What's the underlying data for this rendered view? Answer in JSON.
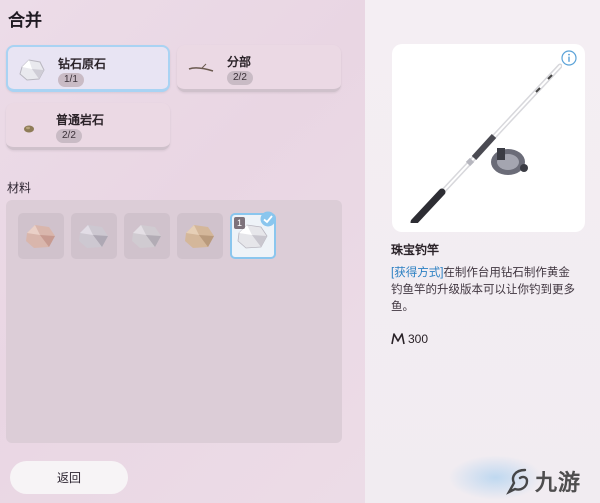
{
  "header": {
    "title": "合并"
  },
  "recipes": [
    {
      "name": "钻石原石",
      "count": "1/1",
      "icon": "diamond-ore-icon",
      "selected": true
    },
    {
      "name": "分部",
      "count": "2/2",
      "icon": "branch-icon",
      "selected": false
    },
    {
      "name": "普通岩石",
      "count": "2/2",
      "icon": "common-rock-icon",
      "selected": false
    }
  ],
  "materials": {
    "label": "材料",
    "slots": [
      {
        "icon": "pink-stone-icon",
        "count": "",
        "selected": false
      },
      {
        "icon": "gray-stone-icon",
        "count": "",
        "selected": false
      },
      {
        "icon": "gray-stone-icon",
        "count": "",
        "selected": false
      },
      {
        "icon": "tan-stone-icon",
        "count": "",
        "selected": false
      },
      {
        "icon": "diamond-ore-icon",
        "count": "1",
        "selected": true
      }
    ]
  },
  "footer": {
    "back_label": "返回"
  },
  "item": {
    "name": "珠宝钓竿",
    "source_label": "[获得方式]",
    "description": "在制作台用钻石制作黄金钓鱼竿的升级版本可以让你钓到更多鱼。",
    "price": "300",
    "price_icon": "currency-icon",
    "image": "fishing-rod-icon"
  },
  "watermark": {
    "text": "九游"
  },
  "colors": {
    "accent": "#8ac6ee",
    "source_label": "#2a7fc2",
    "background": "#ecdce8"
  }
}
